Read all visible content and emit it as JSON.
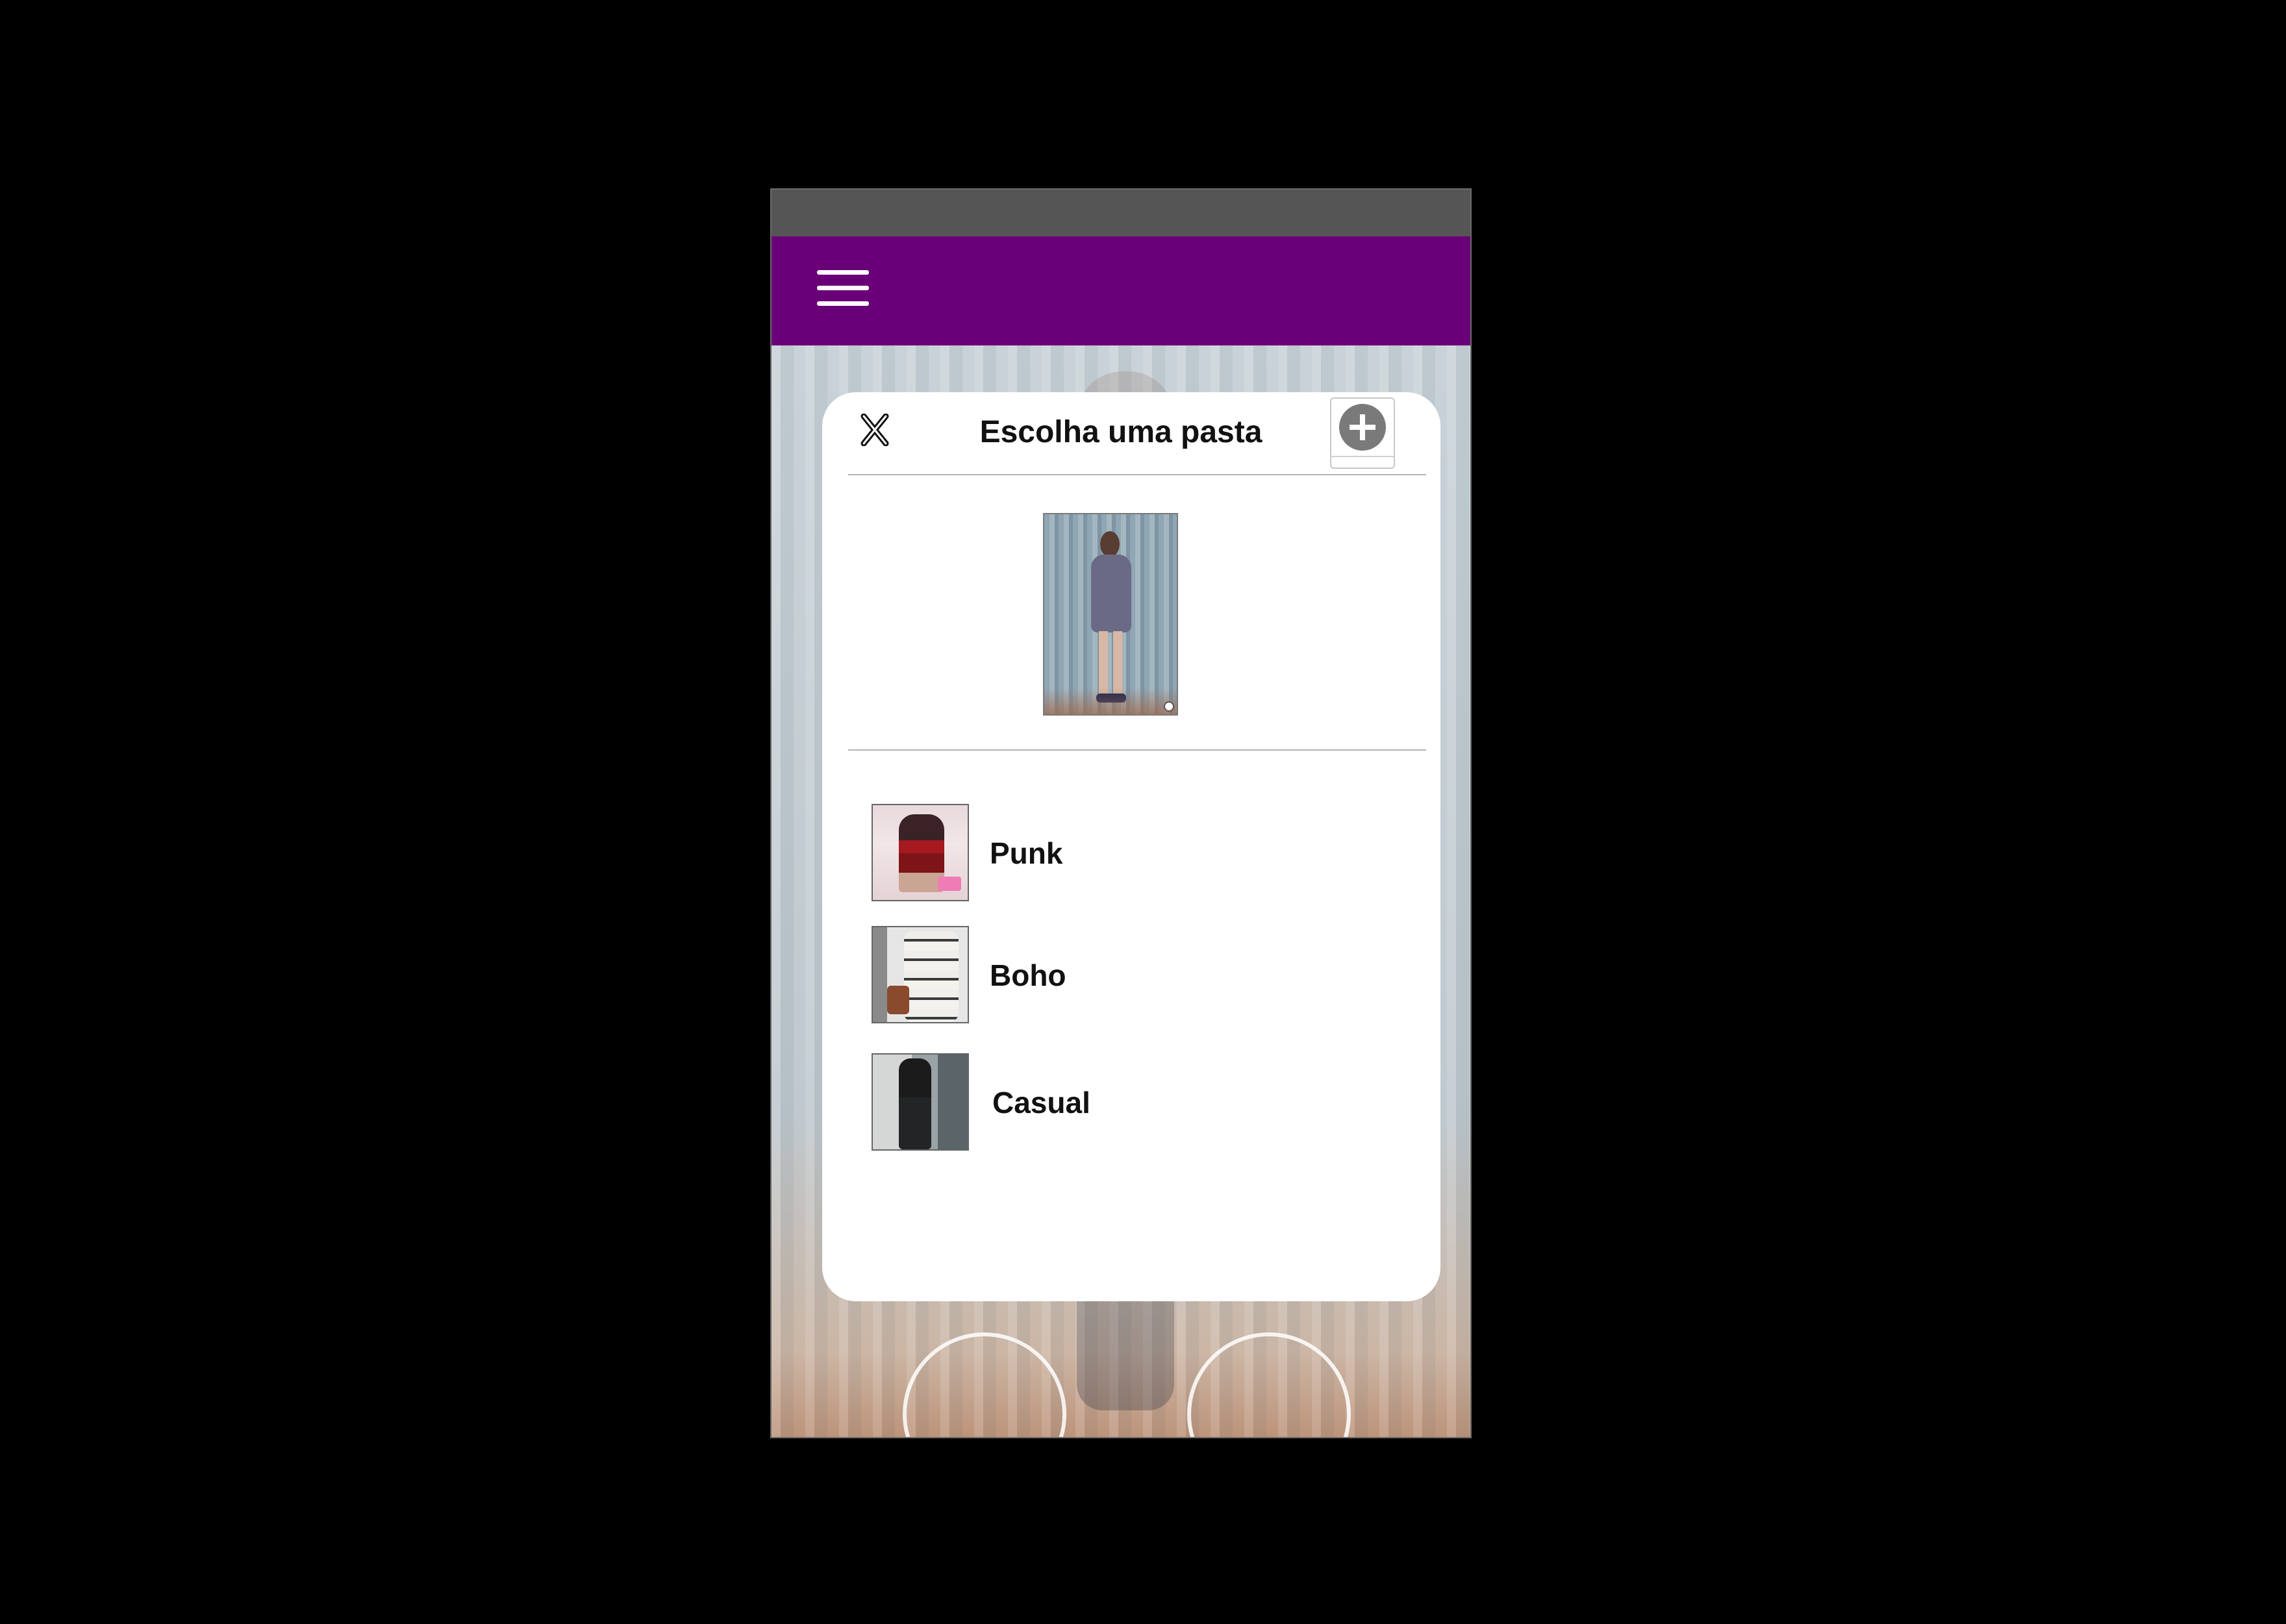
{
  "app_bar": {
    "background_color": "#6a0077",
    "menu_icon": "hamburger-menu-icon"
  },
  "status_bar": {
    "background_color": "#555555"
  },
  "modal": {
    "title": "Escolha uma pasta",
    "close_icon": "close-icon",
    "add_icon": "add-folder-icon"
  },
  "folders": [
    {
      "label": "Punk"
    },
    {
      "label": "Boho"
    },
    {
      "label": "Casual"
    }
  ]
}
